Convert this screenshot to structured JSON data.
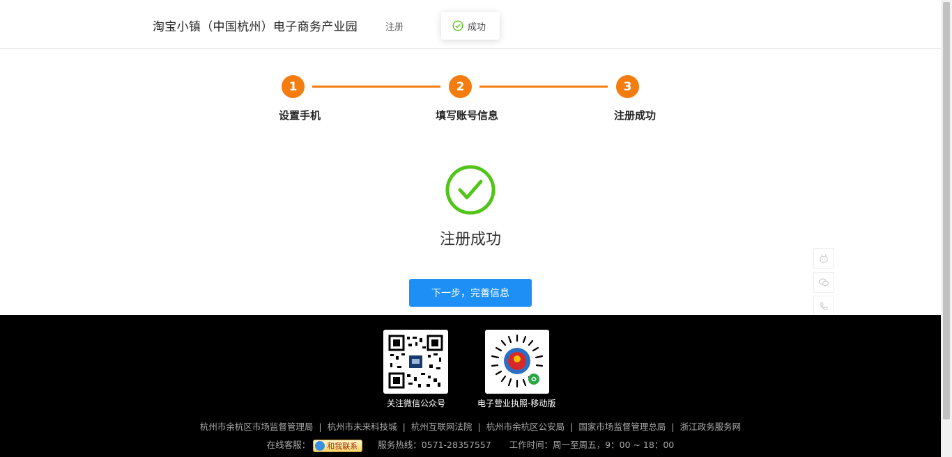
{
  "header": {
    "site_title": "淘宝小镇（中国杭州）电子商务产业园",
    "register_link": "注册",
    "toast_text": "成功"
  },
  "steps": [
    {
      "number": "1",
      "label": "设置手机"
    },
    {
      "number": "2",
      "label": "填写账号信息"
    },
    {
      "number": "3",
      "label": "注册成功"
    }
  ],
  "main": {
    "success_title": "注册成功",
    "next_button_label": "下一步，完善信息"
  },
  "side_tools": [
    "robot-icon",
    "wechat-icon",
    "phone-icon"
  ],
  "footer": {
    "qr_codes": [
      {
        "label": "关注微信公众号"
      },
      {
        "label": "电子营业执照-移动版"
      }
    ],
    "links": [
      "杭州市余杭区市场监督管理局",
      "杭州市未来科技城",
      "杭州互联网法院",
      "杭州市余杭区公安局",
      "国家市场监督管理总局",
      "浙江政务服务网"
    ],
    "separator": "|",
    "online_service_label": "在线客服：",
    "contact_badge_label": "和我联系",
    "hotline": "服务热线：0571-28357557",
    "work_hours": "工作时间：周一至周五，9：00 ~ 18：00"
  },
  "colors": {
    "accent_orange": "#f57c0f",
    "success_green": "#52c41a",
    "primary_blue": "#1e90f5",
    "footer_bg": "#000000"
  }
}
